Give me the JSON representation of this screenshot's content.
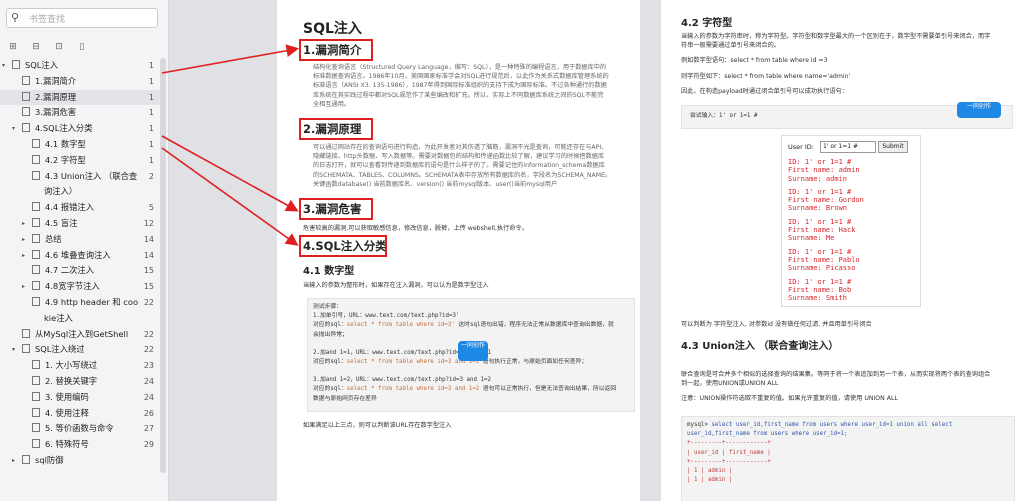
{
  "sidebar": {
    "search_placeholder": "书签查找",
    "items": [
      {
        "label": "SQL注入",
        "page": "1",
        "indent": 0,
        "arrow": "▾",
        "doc": true
      },
      {
        "label": "1.漏洞简介",
        "page": "1",
        "indent": 1,
        "doc": true
      },
      {
        "label": "2.漏洞原理",
        "page": "1",
        "indent": 1,
        "doc": true,
        "selected": true
      },
      {
        "label": "3.漏洞危害",
        "page": "1",
        "indent": 1,
        "doc": true
      },
      {
        "label": "4.SQL注入分类",
        "page": "1",
        "indent": 1,
        "arrow": "▾",
        "doc": true
      },
      {
        "label": "4.1 数字型",
        "page": "1",
        "indent": 2,
        "doc": true
      },
      {
        "label": "4.2 字符型",
        "page": "1",
        "indent": 2,
        "doc": true
      },
      {
        "label": "4.3 Union注入 （联合查",
        "label2": "询注入）",
        "page": "2",
        "indent": 2,
        "doc": true,
        "double": true
      },
      {
        "label": "4.4 报错注入",
        "page": "5",
        "indent": 2,
        "doc": true
      },
      {
        "label": "4.5 盲注",
        "page": "12",
        "indent": 2,
        "arrow": "▸",
        "doc": true
      },
      {
        "label": "总结",
        "page": "14",
        "indent": 2,
        "arrow": "▸",
        "doc": true
      },
      {
        "label": "4.6 堆叠查询注入",
        "page": "14",
        "indent": 2,
        "arrow": "▸",
        "doc": true
      },
      {
        "label": "4.7 二次注入",
        "page": "15",
        "indent": 2,
        "doc": true
      },
      {
        "label": "4.8宽字节注入",
        "page": "15",
        "indent": 2,
        "arrow": "▸",
        "doc": true
      },
      {
        "label": "4.9 http header 和 coo",
        "label2": "kie注入",
        "page": "22",
        "indent": 2,
        "doc": true,
        "double": true
      },
      {
        "label": "从MySql注入到GetShell",
        "page": "22",
        "indent": 1,
        "doc": true
      },
      {
        "label": "SQL注入绕过",
        "page": "22",
        "indent": 1,
        "arrow": "▾",
        "doc": true
      },
      {
        "label": "1. 大小写绕过",
        "page": "23",
        "indent": 2,
        "doc": true
      },
      {
        "label": "2. 替换关键字",
        "page": "24",
        "indent": 2,
        "doc": true
      },
      {
        "label": "3. 使用编码",
        "page": "24",
        "indent": 2,
        "doc": true
      },
      {
        "label": "4. 使用注释",
        "page": "26",
        "indent": 2,
        "doc": true
      },
      {
        "label": "5. 等价函数与命令",
        "page": "27",
        "indent": 2,
        "doc": true
      },
      {
        "label": "6. 特殊符号",
        "page": "29",
        "indent": 2,
        "doc": true
      },
      {
        "label": "sql防御",
        "page": "",
        "indent": 1,
        "arrow": "▸",
        "doc": true
      }
    ]
  },
  "page1": {
    "title": "SQL注入",
    "s1_heading": "1.漏洞简介",
    "s1_lines": [
      "结构化查询语言（Structured Query Language，缩写：SQL），是一种特殊的编程语言，用于数据库中的",
      "标准数据查询语言。1986年10月，美国国家标准学会对SQL进行规范后，以此作为关系式数据库管理系统的",
      "标准语言（ANSI X3. 135-1986），1987年得到国际标准组织的支持下成为国际标准。不过各种通行的数据",
      "库系统在其实践过程中都对SQL规范作了某些编改和扩充。所以，实际上不同数据库系统之间的SQL不能完",
      "全相互通用。"
    ],
    "s2_heading": "2.漏洞原理",
    "s2_lines": [
      "可以通过网站存在的查询语句进行构造，为此开发者对其伤透了脑筋，漏洞不光是查询，可能还存在与API、",
      "隐藏链接、http头数据、写入数据等。需要对数据包的结构和传递函数比较了解，建议学习的时候把数据库",
      "的日志打开，就可以查看到传递到数据库的语句是什么样子的了。需要记住的information_schema数据库",
      "的SCHEMATA、TABLES、COLUMNS。SCHEMATA表中存放所有数据库的名，字段名为SCHEMA_NAME。",
      "关键函数database() 当前数据库名、version() 当前mysql版本、user()当前mysql用户"
    ],
    "s3_heading": "3.漏洞危害",
    "s3_line": "危害较高的漏洞,可以获取敏感信息，修改信息，脱裤，上传 webshell,执行命令。",
    "s4_heading": "4.SQL注入分类",
    "s41_heading": "4.1 数字型",
    "s41_intro": "当输入的参数为整形时，如果存在注入漏洞，可以认为是数字型注入",
    "box_title": "测试步骤：",
    "box_l1": "1.加单引号，URL：www.text.com/text.php?id=3'",
    "box_l2a": "对应的sql：",
    "box_l2b": "select * from table where id=3'",
    "box_l2c": " 这时sql语句出错，程序无法正常从数据库中查询出数据，就",
    "box_l3": "会抛出异常；",
    "box_l4": "2.加and 1=1，URL：www.text.com/text.php?id=3 and 1=1",
    "box_l5a": "对应的sql：",
    "box_l5b": "select * from table where id=3 and 1=1",
    "box_l5c": " 语句执行正常，与原始页面如任何差异；",
    "box_l6": "3.加and 1=2，URL：www.text.com/text.php?id=3 and 1=2",
    "box_l7a": "对应的sql：",
    "box_l7b": "select * from table where id=3 and 1=2",
    "box_l7c": " 语句可以正常执行，但是无法查询出结果，所以返回",
    "box_l8": "数据与原始网页存在差异",
    "conclusion": "如果满足以上三点，则可以判断该URL存在数字型注入",
    "watermark": "一同创作"
  },
  "page2": {
    "h42": "4.2 字符型",
    "p1a": "当输入的参数为字符串时，称为字符型。字符型和数字型最大的一个区别在于，数字型不需要单引号来闭合，而字",
    "p1b": "符串一般需要通过单引号来闭合的。",
    "p2": "例如数字型语句：select * from table where id =3",
    "p3": "则字符型如下：select * from table where name='admin'",
    "p4": "因此，在构造payload时通过闭合单引号可以成功执行语句：",
    "test_input": "尝试输入：1' or 1=1 #",
    "demo_label": "User ID:",
    "demo_value": "1' or 1=1 #",
    "demo_submit": "Submit",
    "demo_lines": [
      "ID: 1' or 1=1 #",
      "First name: admin",
      "Surname: admin",
      "ID: 1' or 1=1 #",
      "First name: Gordon",
      "Surname: Brown",
      "ID: 1' or 1=1 #",
      "First name: Hack",
      "Surname: Me",
      "ID: 1' or 1=1 #",
      "First name: Pablo",
      "Surname: Picasso",
      "ID: 1' or 1=1 #",
      "First name: Bob",
      "Surname: Smith"
    ],
    "p5": "可以判断为 字符型注入, 对参数id 没有做任何过滤, 并且用单引号闭合",
    "h43": "4.3 Union注入 （联合查询注入）",
    "p6a": "联合查询是可合并多个相似的选择查询的结果集。等同于将一个表追加到另一个表，从而实现将两个表的查询组合",
    "p6b": "到一起，使用UNION或UNION ALL",
    "p7": "注意：UNION操作符选取不重复的值。如果允许重复的值，请使用 UNION ALL",
    "code1a": "mysql> ",
    "code1b": "select user_id,first_name from users where user_id=1 union all select",
    "code2": "user_id,first_name from users where user_id=1;",
    "code3": "+---------+------------+",
    "code4": "| user_id | first_name |",
    "code5": "+---------+------------+",
    "code6": "|       1 | admin      |",
    "code7": "|       1 | admin      |"
  }
}
